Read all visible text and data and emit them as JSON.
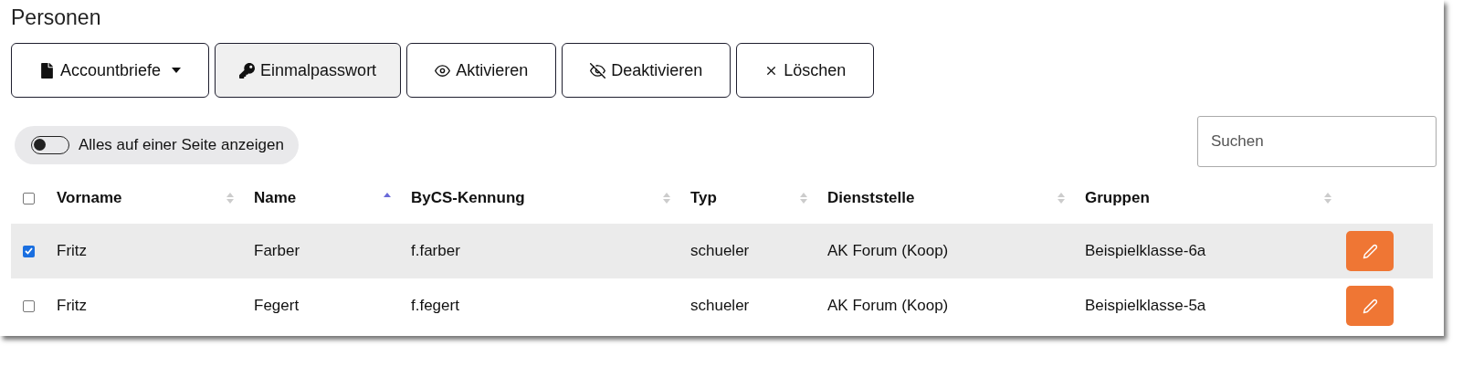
{
  "title": "Personen",
  "actions": [
    {
      "label": "Accountbriefe",
      "dropdown": true,
      "highlighted": false
    },
    {
      "label": "Einmalpasswort",
      "dropdown": false,
      "highlighted": true
    },
    {
      "label": "Aktivieren",
      "dropdown": false,
      "highlighted": false
    },
    {
      "label": "Deaktivieren",
      "dropdown": false,
      "highlighted": false
    },
    {
      "label": "Löschen",
      "dropdown": false,
      "highlighted": false
    }
  ],
  "show_all_toggle": {
    "label": "Alles auf einer Seite anzeigen",
    "on": false
  },
  "search": {
    "placeholder": "Suchen"
  },
  "table": {
    "select_all": {
      "checked": false
    },
    "columns": [
      {
        "label": "Vorname",
        "sorted": false
      },
      {
        "label": "Name",
        "sorted": true
      },
      {
        "label": "ByCS-Kennung",
        "sorted": false
      },
      {
        "label": "Typ",
        "sorted": false
      },
      {
        "label": "Dienststelle",
        "sorted": false
      },
      {
        "label": "Gruppen",
        "sorted": false
      }
    ],
    "rows": [
      {
        "selected": true,
        "cells": [
          "Fritz",
          "Farber",
          "f.farber",
          "schueler",
          "AK Forum (Koop)",
          "Beispielklasse-6a"
        ]
      },
      {
        "selected": false,
        "cells": [
          "Fritz",
          "Fegert",
          "f.fegert",
          "schueler",
          "AK Forum (Koop)",
          "Beispielklasse-5a"
        ]
      }
    ]
  }
}
